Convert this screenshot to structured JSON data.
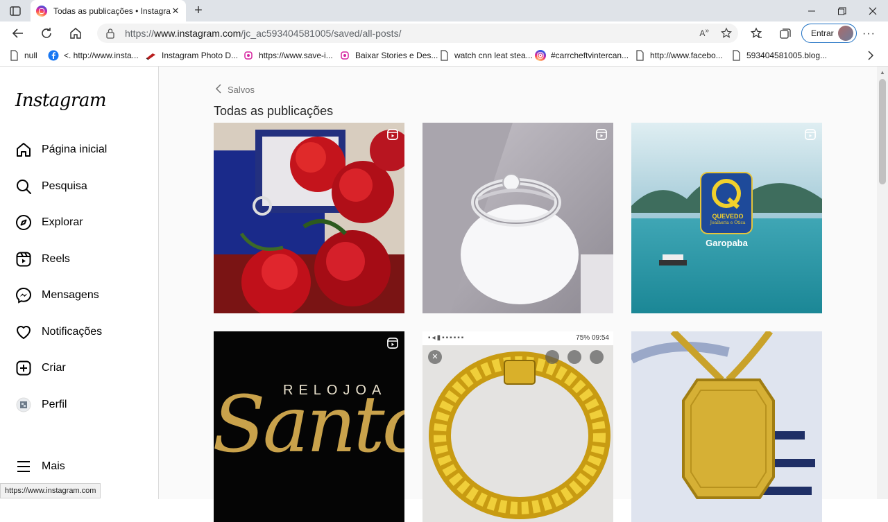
{
  "browser": {
    "tab_title": "Todas as publicações • Instagram",
    "url_prefix": "https://",
    "url_host": "www.instagram.com",
    "url_path": "/jc_ac593404581005/saved/all-posts/",
    "signin_label": "Entrar",
    "status_url": "https://www.instagram.com"
  },
  "bookmarks": [
    {
      "label": "null",
      "icon": "page-icon"
    },
    {
      "label": "<. http://www.insta...",
      "icon": "facebook-icon"
    },
    {
      "label": "Instagram Photo D...",
      "icon": "pen-icon"
    },
    {
      "label": "https://www.save-i...",
      "icon": "saveinsta-icon"
    },
    {
      "label": "Baixar Stories e Des...",
      "icon": "saveinsta-icon"
    },
    {
      "label": "watch cnn leat stea...",
      "icon": "page-icon"
    },
    {
      "label": "#carrcheftvintercan...",
      "icon": "instagram-icon"
    },
    {
      "label": "http://www.facebo...",
      "icon": "page-icon"
    },
    {
      "label": "593404581005.blog...",
      "icon": "page-icon"
    }
  ],
  "sidebar": {
    "logo": "Instagram",
    "items": [
      {
        "label": "Página inicial",
        "icon": "home-icon"
      },
      {
        "label": "Pesquisa",
        "icon": "search-icon"
      },
      {
        "label": "Explorar",
        "icon": "compass-icon"
      },
      {
        "label": "Reels",
        "icon": "reels-icon"
      },
      {
        "label": "Mensagens",
        "icon": "messenger-icon"
      },
      {
        "label": "Notificações",
        "icon": "heart-icon"
      },
      {
        "label": "Criar",
        "icon": "plus-square-icon"
      },
      {
        "label": "Perfil",
        "icon": "profile-avatar-icon"
      },
      {
        "label": "Mais",
        "icon": "menu-icon"
      }
    ]
  },
  "main": {
    "back_label": "Salvos",
    "heading": "Todas as publicações",
    "posts": [
      {
        "kind": "roses-ring",
        "reel": true
      },
      {
        "kind": "ring",
        "reel": true
      },
      {
        "kind": "garopaba",
        "reel": true,
        "brand_line1": "QUEVEDO",
        "brand_line2": "Joalheria e Ótica",
        "caption": "Garopaba"
      },
      {
        "kind": "relojoaria",
        "reel": true,
        "text_top": "RELOJOA",
        "text_script": "Santo"
      },
      {
        "kind": "bracelet",
        "reel": false,
        "status_text": "75% 09:54"
      },
      {
        "kind": "pendant",
        "reel": false
      }
    ]
  },
  "colors": {
    "accent": "#0095f6",
    "border": "#dbdbdb",
    "text": "#262626",
    "muted": "#737373"
  }
}
